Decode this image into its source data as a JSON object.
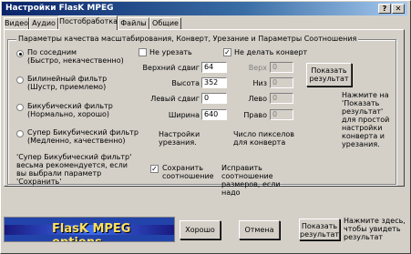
{
  "window": {
    "title": "Настройки FlasK MPEG"
  },
  "tabs": [
    {
      "label": "Видео"
    },
    {
      "label": "Аудио"
    },
    {
      "label": "Постобработка"
    },
    {
      "label": "Файлы"
    },
    {
      "label": "Общие"
    }
  ],
  "group": {
    "title": "Параметры качества масштабирования, Конверт, Урезание и Параметры Соотношения"
  },
  "filters": [
    {
      "label": "По соседним",
      "desc": "(Быстро, некачественно)",
      "selected": true
    },
    {
      "label": "Билинейный фильтр",
      "desc": "(Шустр, приемлемо)",
      "selected": false
    },
    {
      "label": "Бикубический фильтр",
      "desc": "(Нормально, хорошо)",
      "selected": false
    },
    {
      "label": "Супер Бикубический фильтр",
      "desc": "(Медленно, качественно)",
      "selected": false
    }
  ],
  "filter_note": "'Супер Бикубический фильтр' весьма рекомендуется, если вы выбрали параметр 'Сохранить'",
  "crop": {
    "checkbox_label": "Не урезать",
    "fields": [
      {
        "label": "Верхний сдвиг",
        "value": "64"
      },
      {
        "label": "Высота",
        "value": "352"
      },
      {
        "label": "Левый сдвиг",
        "value": "0"
      },
      {
        "label": "Ширина",
        "value": "640"
      }
    ],
    "note": "Настройки урезания."
  },
  "letterbox": {
    "checkbox_label": "Не делать конверт",
    "fields": [
      {
        "label": "Верх",
        "value": "0"
      },
      {
        "label": "Низ",
        "value": "0"
      },
      {
        "label": "Лево",
        "value": "0"
      },
      {
        "label": "Право",
        "value": "0"
      }
    ],
    "note": "Число пикселов для конверта"
  },
  "show_result_button": "Показать результат",
  "show_result_hint": "Нажмите на 'Показать результат' для простой настройки конверта и урезания.",
  "keep_ratio": {
    "label": "Сохранить соотношение",
    "checked": true,
    "hint": "Исправить соотношение размеров, если надо"
  },
  "logo_text": "FlasK MPEG options",
  "footer": {
    "ok": "Хорошо",
    "cancel": "Отмена",
    "show_result": "Показать результат",
    "hint": "Нажмите здесь, чтобы увидеть результат"
  }
}
